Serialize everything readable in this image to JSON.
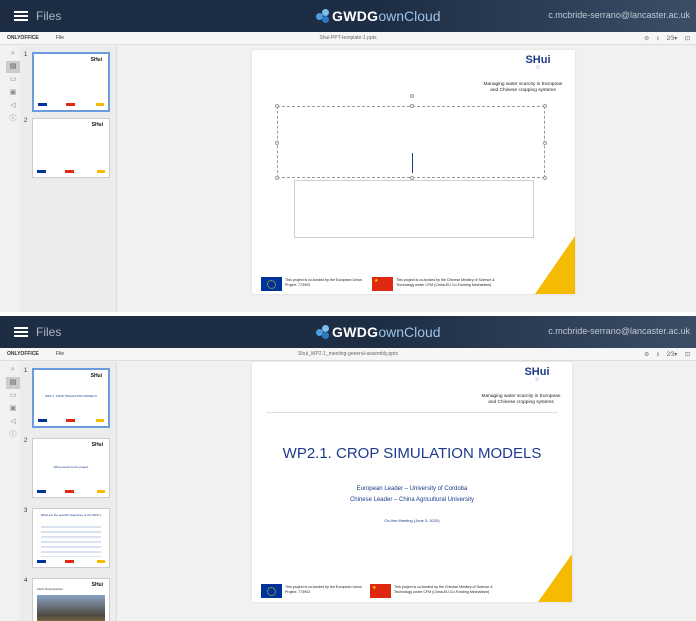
{
  "panes": [
    {
      "app": {
        "files_label": "Files",
        "logo_text": "GWDG",
        "logo_text2": "ownCloud",
        "user": "c.mcbride-serrano@lancaster.ac.uk"
      },
      "menu": {
        "brand": "ONLYOFFICE",
        "file": "File",
        "doc_title": "Shui-PPT-template-1.pptx",
        "tools": "⊜ ⭳ 2⁄3▾ ⊡"
      },
      "thumbs": [
        {
          "num": "1"
        },
        {
          "num": "2"
        }
      ],
      "slide": {
        "logo_name": "SHui",
        "tagline": "Managing water scarcity in European\nand Chinese cropping systems",
        "footer_eu": "This project is co-funded by the European Union\nProject: 773903",
        "footer_cn": "This project is co-funded by the Chinese Ministry of Science &\nTechnology under CFM (China-EU Co-Funding Mechanism)"
      }
    },
    {
      "app": {
        "files_label": "Files",
        "logo_text": "GWDG",
        "logo_text2": "ownCloud",
        "user": "c.mcbride-serrano@lancaster.ac.uk"
      },
      "menu": {
        "brand": "ONLYOFFICE",
        "file": "File",
        "doc_title": "Shui_WP2.1_meeting-general-assembly.pptx",
        "tools": "⊜ ⭳ 2⁄3▾ ⊡"
      },
      "thumbs": [
        {
          "num": "1",
          "title": "WP2.1. CROP SIMULATION MODELS"
        },
        {
          "num": "2",
          "title": "What would be the project"
        },
        {
          "num": "3",
          "title": "What are the specific objectives of the WP2.1"
        },
        {
          "num": "4",
          "title": "Field: Reproduction"
        }
      ],
      "slide": {
        "logo_name": "SHui",
        "tagline": "Managing water scarcity in European\nand Chinese cropping systems",
        "title": "WP2.1. CROP SIMULATION MODELS",
        "leader_eu": "European Leader – University of Cordoba",
        "leader_cn": "Chinese Leader – China Agricultural University",
        "meeting": "On-line Meeting (June 3, 2020)",
        "footer_eu": "This project is co-funded by the European Union\nProject: 773903",
        "footer_cn": "This project is co-funded by the Chinese Ministry of Science &\nTechnology under CFM (China-EU Co-Funding Mechanism)"
      }
    }
  ],
  "left_icons": [
    "search-icon",
    "slides-icon",
    "comments-icon",
    "chat-icon",
    "speaker-icon",
    "info-icon"
  ],
  "colors": {
    "header": "#1d2d44",
    "accent_blue": "#1c3b8c",
    "yellow": "#f5bb00"
  }
}
